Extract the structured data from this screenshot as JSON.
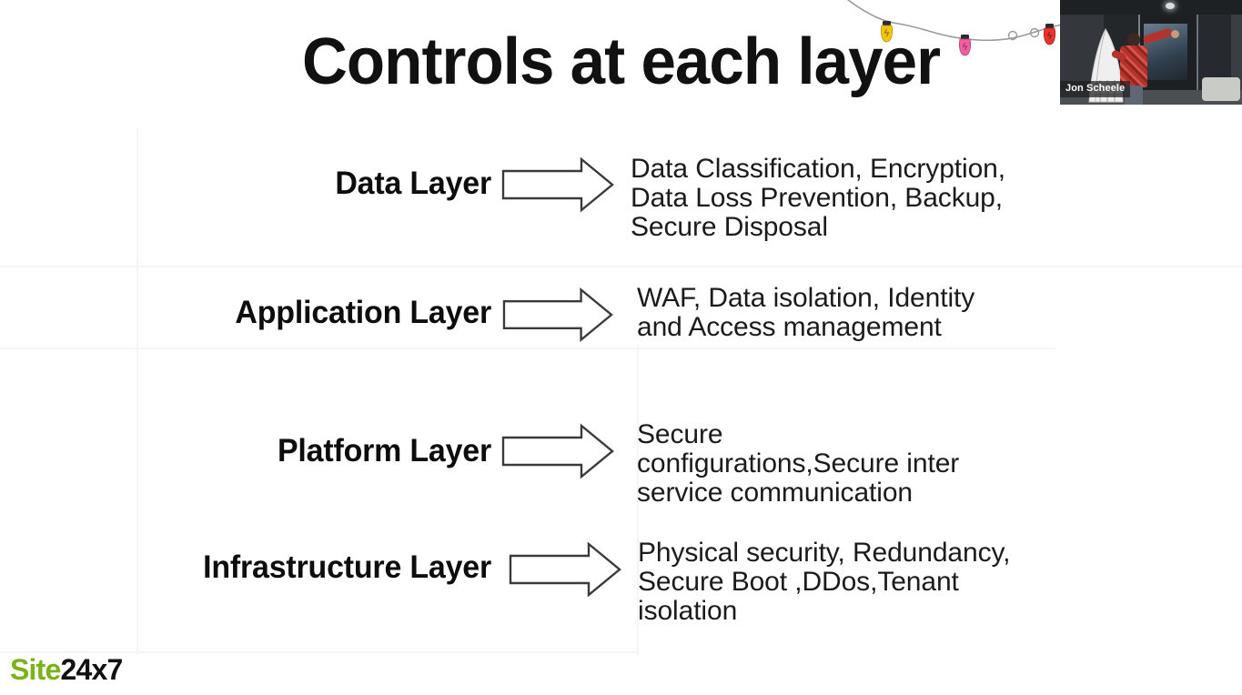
{
  "slide": {
    "title": "Controls at each layer",
    "background_color": "#ffffff",
    "rows": [
      {
        "label": "Data Layer",
        "arrow_icon": "right-block-arrow-icon",
        "description": "Data Classification, Encryption, Data Loss Prevention, Backup, Secure Disposal"
      },
      {
        "label": "Application Layer",
        "arrow_icon": "right-block-arrow-icon",
        "description": "WAF, Data isolation, Identity and Access management"
      },
      {
        "label": "Platform Layer",
        "arrow_icon": "right-block-arrow-icon",
        "description": "Secure configurations,Secure inter service communication"
      },
      {
        "label": "Infrastructure Layer",
        "arrow_icon": "right-block-arrow-icon",
        "description": "Physical security, Redundancy, Secure Boot ,DDos,Tenant isolation"
      }
    ]
  },
  "logo": {
    "name": "site24x7-logo",
    "part_green": "Site",
    "part_black": "24x7",
    "green_color": "#7ab317",
    "black_color": "#111111"
  },
  "decoration": {
    "string_lights": {
      "name": "string-lights-decoration",
      "bulb_colors": [
        "#f2c413",
        "#ef5fa0",
        "#e8342c"
      ]
    }
  },
  "webcam": {
    "name": "presenter-webcam-overlay",
    "presenter_name": "Jon Scheele"
  }
}
